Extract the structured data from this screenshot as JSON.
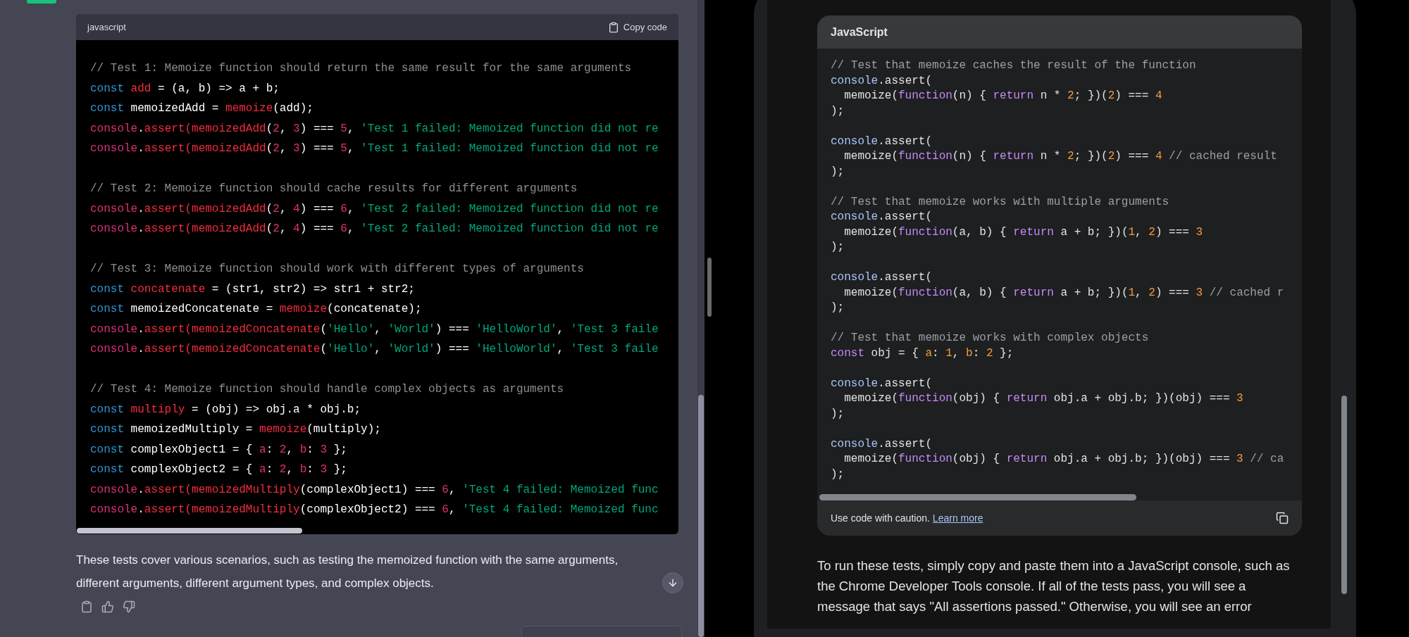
{
  "left_chat": {
    "code_block": {
      "language": "javascript",
      "copy_label": "Copy code",
      "lines": [
        {
          "kind": "code",
          "tokens": [
            {
              "text": "// Test 1: Memoize function should return the same result for the same arguments",
              "kind": "comment"
            }
          ]
        },
        {
          "kind": "code",
          "tokens": [
            {
              "text": "const ",
              "kind": "keyword"
            },
            {
              "text": "add",
              "kind": "name"
            },
            {
              "text": " = (a, b) => a + b;",
              "kind": "plain"
            }
          ]
        },
        {
          "kind": "code",
          "tokens": [
            {
              "text": "const",
              "kind": "keyword"
            },
            {
              "text": " memoizedAdd = ",
              "kind": "plain"
            },
            {
              "text": "memoize",
              "kind": "name"
            },
            {
              "text": "(add);",
              "kind": "plain"
            }
          ]
        },
        {
          "kind": "code",
          "tokens": [
            {
              "text": "console",
              "kind": "call"
            },
            {
              "text": ".",
              "kind": "plain"
            },
            {
              "text": "assert(memoizedAdd",
              "kind": "name"
            },
            {
              "text": "(",
              "kind": "plain"
            },
            {
              "text": "2",
              "kind": "number"
            },
            {
              "text": ", ",
              "kind": "plain"
            },
            {
              "text": "3",
              "kind": "number"
            },
            {
              "text": ") === ",
              "kind": "plain"
            },
            {
              "text": "5",
              "kind": "number"
            },
            {
              "text": ", ",
              "kind": "plain"
            },
            {
              "text": "'Test 1 failed: Memoized function did not re",
              "kind": "string"
            }
          ]
        },
        {
          "kind": "code",
          "tokens": [
            {
              "text": "console",
              "kind": "call"
            },
            {
              "text": ".",
              "kind": "plain"
            },
            {
              "text": "assert(memoizedAdd",
              "kind": "name"
            },
            {
              "text": "(",
              "kind": "plain"
            },
            {
              "text": "2",
              "kind": "number"
            },
            {
              "text": ", ",
              "kind": "plain"
            },
            {
              "text": "3",
              "kind": "number"
            },
            {
              "text": ") === ",
              "kind": "plain"
            },
            {
              "text": "5",
              "kind": "number"
            },
            {
              "text": ", ",
              "kind": "plain"
            },
            {
              "text": "'Test 1 failed: Memoized function did not re",
              "kind": "string"
            }
          ]
        },
        {
          "kind": "blank"
        },
        {
          "kind": "code",
          "tokens": [
            {
              "text": "// Test 2: Memoize function should cache results for different arguments",
              "kind": "comment"
            }
          ]
        },
        {
          "kind": "code",
          "tokens": [
            {
              "text": "console",
              "kind": "call"
            },
            {
              "text": ".",
              "kind": "plain"
            },
            {
              "text": "assert(memoizedAdd",
              "kind": "name"
            },
            {
              "text": "(",
              "kind": "plain"
            },
            {
              "text": "2",
              "kind": "number"
            },
            {
              "text": ", ",
              "kind": "plain"
            },
            {
              "text": "4",
              "kind": "number"
            },
            {
              "text": ") === ",
              "kind": "plain"
            },
            {
              "text": "6",
              "kind": "number"
            },
            {
              "text": ", ",
              "kind": "plain"
            },
            {
              "text": "'Test 2 failed: Memoized function did not re",
              "kind": "string"
            }
          ]
        },
        {
          "kind": "code",
          "tokens": [
            {
              "text": "console",
              "kind": "call"
            },
            {
              "text": ".",
              "kind": "plain"
            },
            {
              "text": "assert(memoizedAdd",
              "kind": "name"
            },
            {
              "text": "(",
              "kind": "plain"
            },
            {
              "text": "2",
              "kind": "number"
            },
            {
              "text": ", ",
              "kind": "plain"
            },
            {
              "text": "4",
              "kind": "number"
            },
            {
              "text": ") === ",
              "kind": "plain"
            },
            {
              "text": "6",
              "kind": "number"
            },
            {
              "text": ", ",
              "kind": "plain"
            },
            {
              "text": "'Test 2 failed: Memoized function did not re",
              "kind": "string"
            }
          ]
        },
        {
          "kind": "blank"
        },
        {
          "kind": "code",
          "tokens": [
            {
              "text": "// Test 3: Memoize function should work with different types of arguments",
              "kind": "comment"
            }
          ]
        },
        {
          "kind": "code",
          "tokens": [
            {
              "text": "const ",
              "kind": "keyword"
            },
            {
              "text": "concatenate",
              "kind": "name"
            },
            {
              "text": " = (str1, str2) => str1 + str2;",
              "kind": "plain"
            }
          ]
        },
        {
          "kind": "code",
          "tokens": [
            {
              "text": "const",
              "kind": "keyword"
            },
            {
              "text": " memoizedConcatenate = ",
              "kind": "plain"
            },
            {
              "text": "memoize",
              "kind": "name"
            },
            {
              "text": "(concatenate);",
              "kind": "plain"
            }
          ]
        },
        {
          "kind": "code",
          "tokens": [
            {
              "text": "console",
              "kind": "call"
            },
            {
              "text": ".",
              "kind": "plain"
            },
            {
              "text": "assert(memoizedConcatenate",
              "kind": "name"
            },
            {
              "text": "(",
              "kind": "plain"
            },
            {
              "text": "'Hello'",
              "kind": "string"
            },
            {
              "text": ", ",
              "kind": "plain"
            },
            {
              "text": "'World'",
              "kind": "string"
            },
            {
              "text": ") === ",
              "kind": "plain"
            },
            {
              "text": "'HelloWorld'",
              "kind": "string"
            },
            {
              "text": ", ",
              "kind": "plain"
            },
            {
              "text": "'Test 3 faile",
              "kind": "string"
            }
          ]
        },
        {
          "kind": "code",
          "tokens": [
            {
              "text": "console",
              "kind": "call"
            },
            {
              "text": ".",
              "kind": "plain"
            },
            {
              "text": "assert(memoizedConcatenate",
              "kind": "name"
            },
            {
              "text": "(",
              "kind": "plain"
            },
            {
              "text": "'Hello'",
              "kind": "string"
            },
            {
              "text": ", ",
              "kind": "plain"
            },
            {
              "text": "'World'",
              "kind": "string"
            },
            {
              "text": ") === ",
              "kind": "plain"
            },
            {
              "text": "'HelloWorld'",
              "kind": "string"
            },
            {
              "text": ", ",
              "kind": "plain"
            },
            {
              "text": "'Test 3 faile",
              "kind": "string"
            }
          ]
        },
        {
          "kind": "blank"
        },
        {
          "kind": "code",
          "tokens": [
            {
              "text": "// Test 4: Memoize function should handle complex objects as arguments",
              "kind": "comment"
            }
          ]
        },
        {
          "kind": "code",
          "tokens": [
            {
              "text": "const ",
              "kind": "keyword"
            },
            {
              "text": "multiply",
              "kind": "name"
            },
            {
              "text": " = (obj) => obj.a * obj.b;",
              "kind": "plain"
            }
          ]
        },
        {
          "kind": "code",
          "tokens": [
            {
              "text": "const",
              "kind": "keyword"
            },
            {
              "text": " memoizedMultiply = ",
              "kind": "plain"
            },
            {
              "text": "memoize",
              "kind": "name"
            },
            {
              "text": "(multiply);",
              "kind": "plain"
            }
          ]
        },
        {
          "kind": "code",
          "tokens": [
            {
              "text": "const",
              "kind": "keyword"
            },
            {
              "text": " complexObject1 = { ",
              "kind": "plain"
            },
            {
              "text": "a",
              "kind": "call"
            },
            {
              "text": ": ",
              "kind": "plain"
            },
            {
              "text": "2",
              "kind": "number"
            },
            {
              "text": ", ",
              "kind": "plain"
            },
            {
              "text": "b",
              "kind": "call"
            },
            {
              "text": ": ",
              "kind": "plain"
            },
            {
              "text": "3",
              "kind": "number"
            },
            {
              "text": " };",
              "kind": "plain"
            }
          ]
        },
        {
          "kind": "code",
          "tokens": [
            {
              "text": "const",
              "kind": "keyword"
            },
            {
              "text": " complexObject2 = { ",
              "kind": "plain"
            },
            {
              "text": "a",
              "kind": "call"
            },
            {
              "text": ": ",
              "kind": "plain"
            },
            {
              "text": "2",
              "kind": "number"
            },
            {
              "text": ", ",
              "kind": "plain"
            },
            {
              "text": "b",
              "kind": "call"
            },
            {
              "text": ": ",
              "kind": "plain"
            },
            {
              "text": "3",
              "kind": "number"
            },
            {
              "text": " };",
              "kind": "plain"
            }
          ]
        },
        {
          "kind": "code",
          "tokens": [
            {
              "text": "console",
              "kind": "call"
            },
            {
              "text": ".",
              "kind": "plain"
            },
            {
              "text": "assert(memoizedMultiply",
              "kind": "name"
            },
            {
              "text": "(complexObject1) === ",
              "kind": "plain"
            },
            {
              "text": "6",
              "kind": "number"
            },
            {
              "text": ", ",
              "kind": "plain"
            },
            {
              "text": "'Test 4 failed: Memoized func",
              "kind": "string"
            }
          ]
        },
        {
          "kind": "code",
          "tokens": [
            {
              "text": "console",
              "kind": "call"
            },
            {
              "text": ".",
              "kind": "plain"
            },
            {
              "text": "assert(memoizedMultiply",
              "kind": "name"
            },
            {
              "text": "(complexObject2) === ",
              "kind": "plain"
            },
            {
              "text": "6",
              "kind": "number"
            },
            {
              "text": ", ",
              "kind": "plain"
            },
            {
              "text": "'Test 4 failed: Memoized func",
              "kind": "string"
            }
          ]
        }
      ]
    },
    "message": "These tests cover various scenarios, such as testing the memoized function with the same arguments, different arguments, different argument types, and complex objects."
  },
  "right_chat": {
    "code_block": {
      "language": "JavaScript",
      "lines": [
        {
          "kind": "code",
          "tokens": [
            {
              "text": "// Test that memoize caches the result of the function",
              "kind": "comment"
            }
          ]
        },
        {
          "kind": "code",
          "tokens": [
            {
              "text": "console",
              "kind": "builtin"
            },
            {
              "text": ".assert(",
              "kind": "plain"
            }
          ]
        },
        {
          "kind": "code",
          "tokens": [
            {
              "text": "  memoize(",
              "kind": "plain"
            },
            {
              "text": "function",
              "kind": "keyword"
            },
            {
              "text": "(n) { ",
              "kind": "plain"
            },
            {
              "text": "return",
              "kind": "keyword"
            },
            {
              "text": " n * ",
              "kind": "plain"
            },
            {
              "text": "2",
              "kind": "number"
            },
            {
              "text": "; })(",
              "kind": "plain"
            },
            {
              "text": "2",
              "kind": "number"
            },
            {
              "text": ") === ",
              "kind": "plain"
            },
            {
              "text": "4",
              "kind": "number"
            }
          ]
        },
        {
          "kind": "code",
          "tokens": [
            {
              "text": ");",
              "kind": "plain"
            }
          ]
        },
        {
          "kind": "blank"
        },
        {
          "kind": "code",
          "tokens": [
            {
              "text": "console",
              "kind": "builtin"
            },
            {
              "text": ".assert(",
              "kind": "plain"
            }
          ]
        },
        {
          "kind": "code",
          "tokens": [
            {
              "text": "  memoize(",
              "kind": "plain"
            },
            {
              "text": "function",
              "kind": "keyword"
            },
            {
              "text": "(n) { ",
              "kind": "plain"
            },
            {
              "text": "return",
              "kind": "keyword"
            },
            {
              "text": " n * ",
              "kind": "plain"
            },
            {
              "text": "2",
              "kind": "number"
            },
            {
              "text": "; })(",
              "kind": "plain"
            },
            {
              "text": "2",
              "kind": "number"
            },
            {
              "text": ") === ",
              "kind": "plain"
            },
            {
              "text": "4",
              "kind": "number"
            },
            {
              "text": " // cached result",
              "kind": "comment"
            }
          ]
        },
        {
          "kind": "code",
          "tokens": [
            {
              "text": ");",
              "kind": "plain"
            }
          ]
        },
        {
          "kind": "blank"
        },
        {
          "kind": "code",
          "tokens": [
            {
              "text": "// Test that memoize works with multiple arguments",
              "kind": "comment"
            }
          ]
        },
        {
          "kind": "code",
          "tokens": [
            {
              "text": "console",
              "kind": "builtin"
            },
            {
              "text": ".assert(",
              "kind": "plain"
            }
          ]
        },
        {
          "kind": "code",
          "tokens": [
            {
              "text": "  memoize(",
              "kind": "plain"
            },
            {
              "text": "function",
              "kind": "keyword"
            },
            {
              "text": "(a, b) { ",
              "kind": "plain"
            },
            {
              "text": "return",
              "kind": "keyword"
            },
            {
              "text": " a + b; })(",
              "kind": "plain"
            },
            {
              "text": "1",
              "kind": "number"
            },
            {
              "text": ", ",
              "kind": "plain"
            },
            {
              "text": "2",
              "kind": "number"
            },
            {
              "text": ") === ",
              "kind": "plain"
            },
            {
              "text": "3",
              "kind": "number"
            }
          ]
        },
        {
          "kind": "code",
          "tokens": [
            {
              "text": ");",
              "kind": "plain"
            }
          ]
        },
        {
          "kind": "blank"
        },
        {
          "kind": "code",
          "tokens": [
            {
              "text": "console",
              "kind": "builtin"
            },
            {
              "text": ".assert(",
              "kind": "plain"
            }
          ]
        },
        {
          "kind": "code",
          "tokens": [
            {
              "text": "  memoize(",
              "kind": "plain"
            },
            {
              "text": "function",
              "kind": "keyword"
            },
            {
              "text": "(a, b) { ",
              "kind": "plain"
            },
            {
              "text": "return",
              "kind": "keyword"
            },
            {
              "text": " a + b; })(",
              "kind": "plain"
            },
            {
              "text": "1",
              "kind": "number"
            },
            {
              "text": ", ",
              "kind": "plain"
            },
            {
              "text": "2",
              "kind": "number"
            },
            {
              "text": ") === ",
              "kind": "plain"
            },
            {
              "text": "3",
              "kind": "number"
            },
            {
              "text": " // cached r",
              "kind": "comment"
            }
          ]
        },
        {
          "kind": "code",
          "tokens": [
            {
              "text": ");",
              "kind": "plain"
            }
          ]
        },
        {
          "kind": "blank"
        },
        {
          "kind": "code",
          "tokens": [
            {
              "text": "// Test that memoize works with complex objects",
              "kind": "comment"
            }
          ]
        },
        {
          "kind": "code",
          "tokens": [
            {
              "text": "const",
              "kind": "keyword"
            },
            {
              "text": " obj = { ",
              "kind": "plain"
            },
            {
              "text": "a",
              "kind": "number"
            },
            {
              "text": ": ",
              "kind": "plain"
            },
            {
              "text": "1",
              "kind": "number"
            },
            {
              "text": ", ",
              "kind": "plain"
            },
            {
              "text": "b",
              "kind": "number"
            },
            {
              "text": ": ",
              "kind": "plain"
            },
            {
              "text": "2",
              "kind": "number"
            },
            {
              "text": " };",
              "kind": "plain"
            }
          ]
        },
        {
          "kind": "blank"
        },
        {
          "kind": "code",
          "tokens": [
            {
              "text": "console",
              "kind": "builtin"
            },
            {
              "text": ".assert(",
              "kind": "plain"
            }
          ]
        },
        {
          "kind": "code",
          "tokens": [
            {
              "text": "  memoize(",
              "kind": "plain"
            },
            {
              "text": "function",
              "kind": "keyword"
            },
            {
              "text": "(obj) { ",
              "kind": "plain"
            },
            {
              "text": "return",
              "kind": "keyword"
            },
            {
              "text": " obj.a + obj.b; })(obj) === ",
              "kind": "plain"
            },
            {
              "text": "3",
              "kind": "number"
            }
          ]
        },
        {
          "kind": "code",
          "tokens": [
            {
              "text": ");",
              "kind": "plain"
            }
          ]
        },
        {
          "kind": "blank"
        },
        {
          "kind": "code",
          "tokens": [
            {
              "text": "console",
              "kind": "builtin"
            },
            {
              "text": ".assert(",
              "kind": "plain"
            }
          ]
        },
        {
          "kind": "code",
          "tokens": [
            {
              "text": "  memoize(",
              "kind": "plain"
            },
            {
              "text": "function",
              "kind": "keyword"
            },
            {
              "text": "(obj) { ",
              "kind": "plain"
            },
            {
              "text": "return",
              "kind": "keyword"
            },
            {
              "text": " obj.a + obj.b; })(obj) === ",
              "kind": "plain"
            },
            {
              "text": "3",
              "kind": "number"
            },
            {
              "text": " // ca",
              "kind": "comment"
            }
          ]
        },
        {
          "kind": "code",
          "tokens": [
            {
              "text": ");",
              "kind": "plain"
            }
          ]
        }
      ],
      "footer_text": "Use code with caution.",
      "footer_link": "Learn more"
    },
    "message": "To run these tests, simply copy and paste them into a JavaScript console, such as the Chrome Developer Tools console. If all of the tests pass, you will see a message that says \"All assertions passed.\" Otherwise, you will see an error"
  }
}
